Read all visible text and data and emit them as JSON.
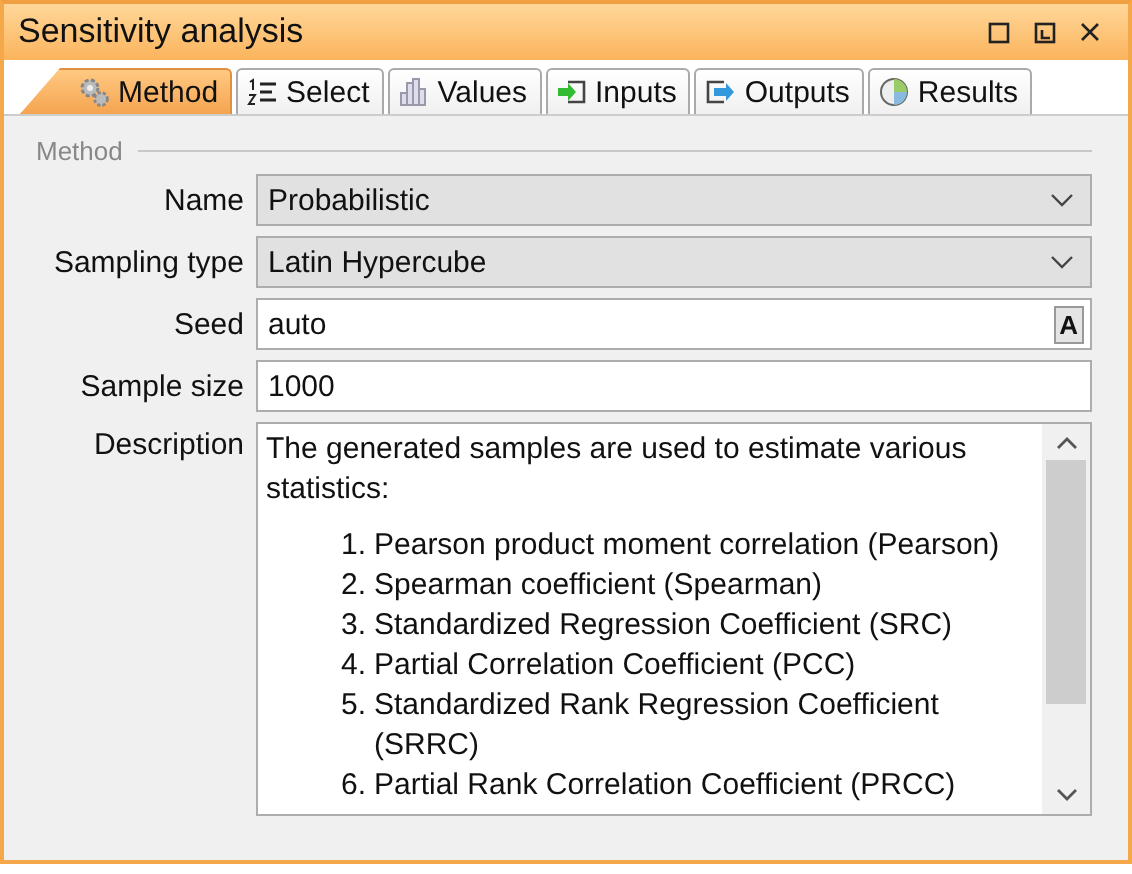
{
  "window": {
    "title": "Sensitivity analysis"
  },
  "tabs": [
    {
      "label": "Method",
      "selected": true
    },
    {
      "label": "Select",
      "selected": false
    },
    {
      "label": "Values",
      "selected": false
    },
    {
      "label": "Inputs",
      "selected": false
    },
    {
      "label": "Outputs",
      "selected": false
    },
    {
      "label": "Results",
      "selected": false
    }
  ],
  "group": {
    "title": "Method"
  },
  "fields": [
    {
      "kind": "combo",
      "label": "Name",
      "value": "Probabilistic"
    },
    {
      "kind": "combo",
      "label": "Sampling type",
      "value": "Latin Hypercube"
    },
    {
      "kind": "auto",
      "label": "Seed",
      "value": "auto",
      "button": "A"
    },
    {
      "kind": "text",
      "label": "Sample size",
      "value": "1000"
    }
  ],
  "description": {
    "label": "Description",
    "intro": "The generated samples are used to estimate various statistics:",
    "items": [
      {
        "number": "1.",
        "text": "Pearson product moment correlation (Pearson)"
      },
      {
        "number": "2.",
        "text": "Spearman coefficient (Spearman)"
      },
      {
        "number": "3.",
        "text": "Standardized Regression Coefficient (SRC)"
      },
      {
        "number": "4.",
        "text": "Partial Correlation Coefficient (PCC)"
      },
      {
        "number": "5.",
        "text": "Standardized Rank Regression Coefficient (SRRC)"
      },
      {
        "number": "6.",
        "text": "Partial Rank Correlation Coefficient (PRCC)"
      }
    ]
  }
}
